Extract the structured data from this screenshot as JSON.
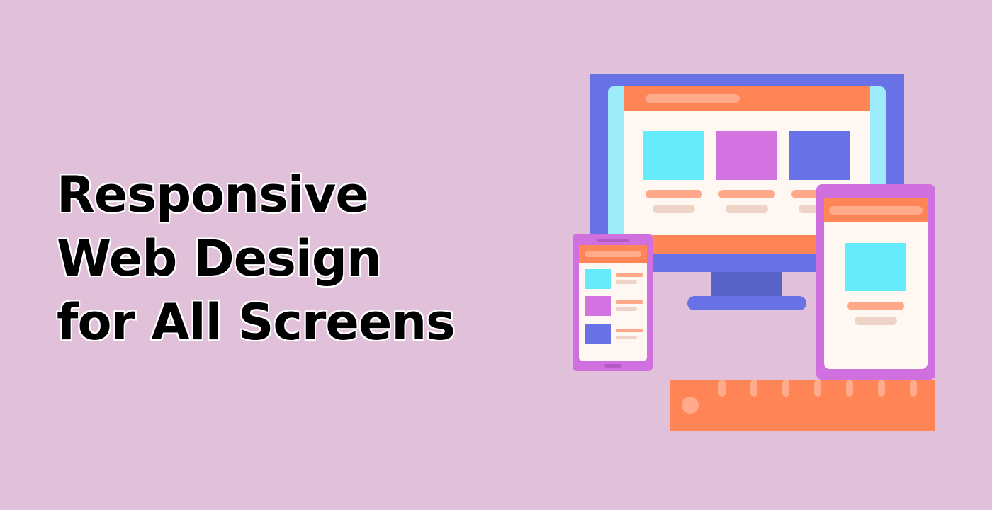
{
  "headline": {
    "lines": [
      "Responsive",
      "Web Design",
      "for All Screens"
    ]
  },
  "illustration": {
    "devices": [
      "desktop-monitor",
      "smartphone",
      "tablet",
      "ruler"
    ],
    "colors": {
      "background": "#e1c1d9",
      "monitor_frame": "#6872e6",
      "monitor_stand": "#5a63c8",
      "screen_edge": "#9eecfa",
      "header_orange": "#ff8556",
      "content_cream": "#fff7f1",
      "card_cyan": "#66ebfa",
      "card_purple": "#d273e1",
      "card_blue": "#6872e6",
      "line_salmon": "#ffa98a",
      "line_beige": "#edd4c6",
      "device_purple": "#d070df",
      "ruler_orange": "#ff8556",
      "ruler_tick": "#ffab8b"
    }
  }
}
